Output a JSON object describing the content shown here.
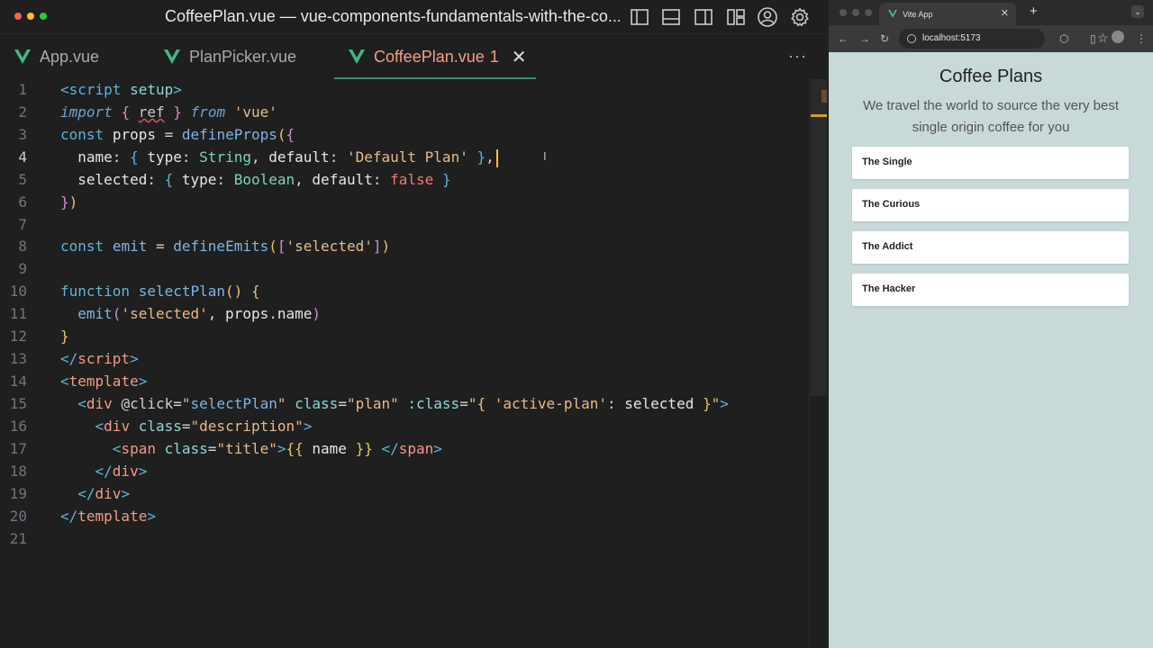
{
  "editor": {
    "title": "CoffeePlan.vue — vue-components-fundamentals-with-the-co...",
    "tabs": [
      {
        "label": "App.vue"
      },
      {
        "label": "PlanPicker.vue"
      },
      {
        "label": "CoffeePlan.vue",
        "badge": "1"
      }
    ],
    "more_label": "···",
    "line_numbers": [
      "1",
      "2",
      "3",
      "4",
      "5",
      "6",
      "7",
      "8",
      "9",
      "10",
      "11",
      "12",
      "13",
      "14",
      "15",
      "16",
      "17",
      "18",
      "19",
      "20",
      "21"
    ]
  },
  "browser": {
    "tab_title": "Vite App",
    "url": "localhost:5173",
    "new_tab": "+",
    "page": {
      "heading": "Coffee Plans",
      "subtitle": "We travel the world to source the very best single origin coffee for you",
      "plans": [
        "The Single",
        "The Curious",
        "The Addict",
        "The Hacker"
      ]
    }
  },
  "colors": {
    "editor_bg": "#1f1f1f",
    "active_tab": "#f49e85",
    "vue_green": "#41b883",
    "page_bg": "#c9d8d8"
  }
}
